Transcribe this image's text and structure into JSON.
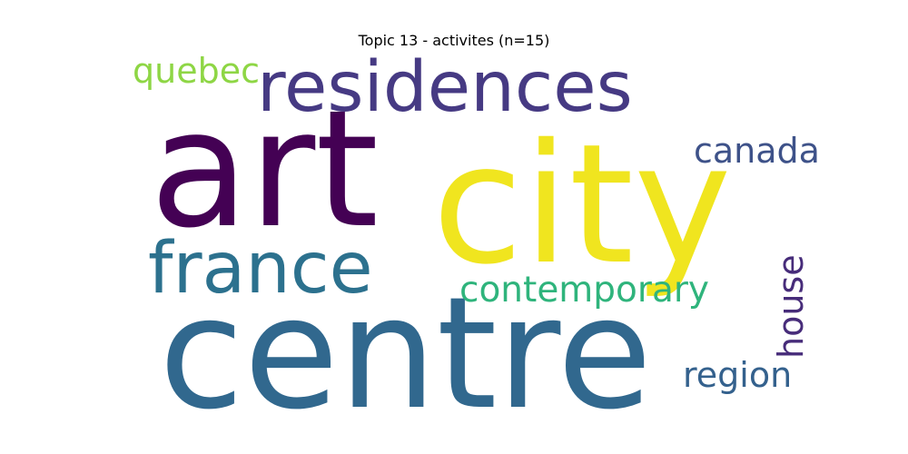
{
  "title": "Topic 13 - activites (n=15)",
  "words": [
    {
      "text": "art",
      "color": "#440154"
    },
    {
      "text": "city",
      "color": "#f0e51f"
    },
    {
      "text": "centre",
      "color": "#31688e"
    },
    {
      "text": "residences",
      "color": "#463a83"
    },
    {
      "text": "france",
      "color": "#2c718e"
    },
    {
      "text": "contemporary",
      "color": "#2fb47c"
    },
    {
      "text": "canada",
      "color": "#3e5289"
    },
    {
      "text": "quebec",
      "color": "#8ed645"
    },
    {
      "text": "house",
      "color": "#472c7a"
    },
    {
      "text": "region",
      "color": "#34618d"
    }
  ]
}
